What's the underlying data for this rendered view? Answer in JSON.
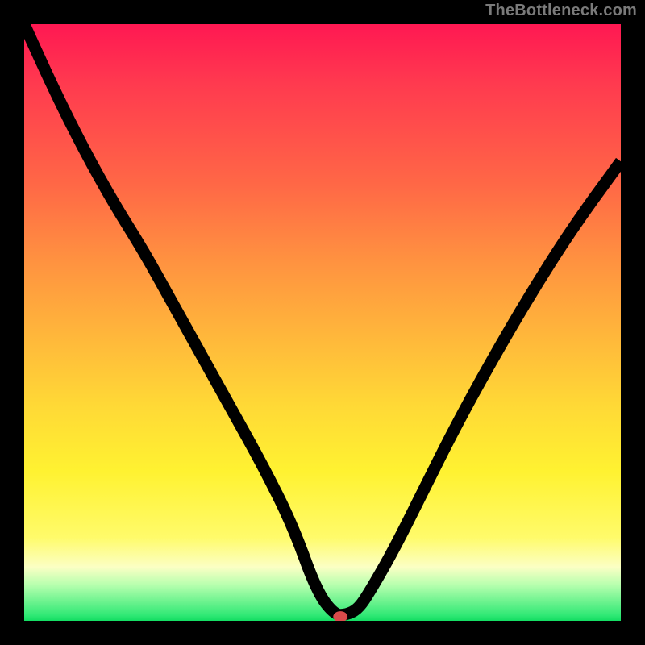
{
  "watermark": "TheBottleneck.com",
  "chart_data": {
    "type": "line",
    "title": "",
    "xlabel": "",
    "ylabel": "",
    "xlim": [
      0,
      100
    ],
    "ylim": [
      0,
      100
    ],
    "grid": false,
    "legend": false,
    "background_gradient": {
      "stops": [
        {
          "pos": 0,
          "color": "#ff1852",
          "meaning": "severe-bottleneck"
        },
        {
          "pos": 50,
          "color": "#ffb63b",
          "meaning": "moderate"
        },
        {
          "pos": 75,
          "color": "#fff231",
          "meaning": "mild"
        },
        {
          "pos": 100,
          "color": "#13dd62",
          "meaning": "no-bottleneck"
        }
      ]
    },
    "series": [
      {
        "name": "bottleneck-curve",
        "x": [
          0,
          5,
          10,
          15,
          20,
          25,
          30,
          35,
          40,
          45,
          49,
          52,
          54,
          56,
          58,
          62,
          67,
          72,
          78,
          85,
          92,
          100
        ],
        "y": [
          100,
          89,
          79,
          70,
          62,
          53,
          44,
          35,
          26,
          16,
          5,
          1,
          1,
          2,
          5,
          12,
          22,
          32,
          43,
          55,
          66,
          77
        ]
      }
    ],
    "marker": {
      "name": "optimal-point",
      "x": 53,
      "y": 0.5,
      "color": "#d94a4a"
    }
  }
}
